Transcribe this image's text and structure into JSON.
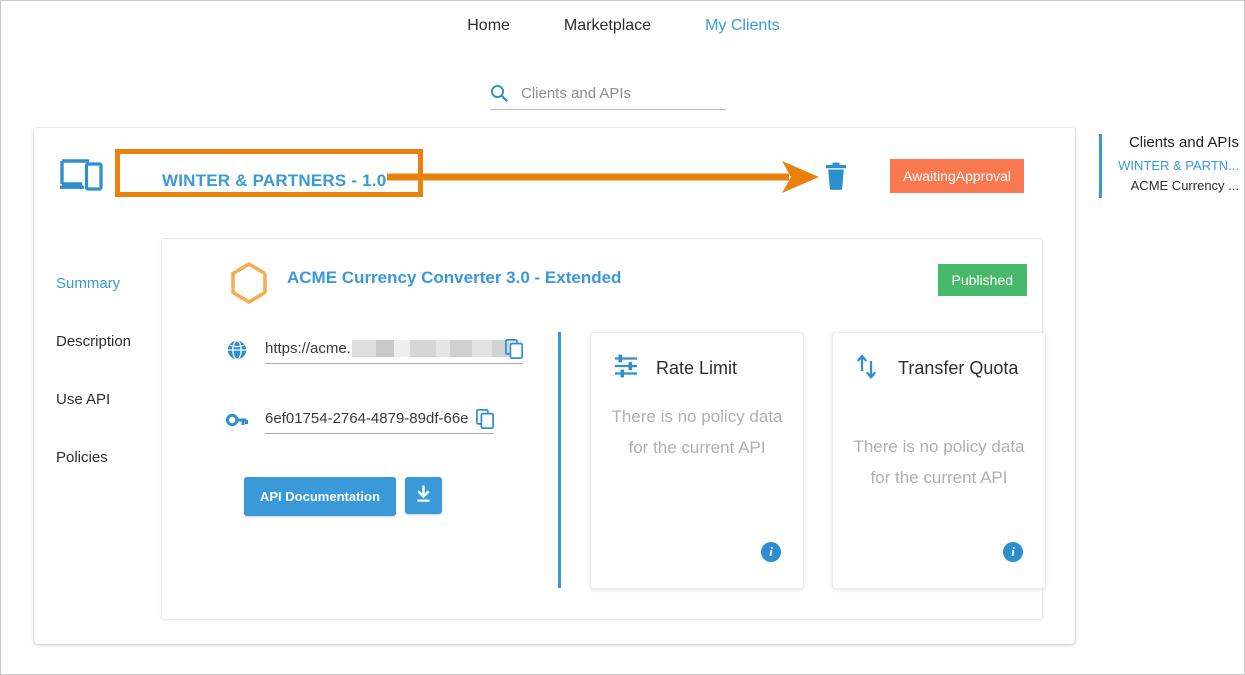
{
  "topnav": {
    "items": [
      {
        "label": "Home",
        "active": false
      },
      {
        "label": "Marketplace",
        "active": false
      },
      {
        "label": "My Clients",
        "active": true
      }
    ]
  },
  "search": {
    "placeholder": "Clients and APIs",
    "value": "",
    "icon": "search-icon"
  },
  "client_header": {
    "icon": "devices-icon",
    "title": "WINTER & PARTNERS - 1.0",
    "delete_icon": "trash-icon",
    "status_label": "AwaitingApproval",
    "status_color": "#f9784f",
    "highlight_color": "#e8820c"
  },
  "tabs": [
    {
      "label": "Summary",
      "active": true
    },
    {
      "label": "Description",
      "active": false
    },
    {
      "label": "Use API",
      "active": false
    },
    {
      "label": "Policies",
      "active": false
    }
  ],
  "api_card": {
    "icon": "hexagon-icon",
    "title": "ACME Currency Converter 3.0 - Extended",
    "state_label": "Published",
    "state_color": "#48b968",
    "fields": [
      {
        "icon": "globe-icon",
        "name": "api-endpoint-url",
        "value": "https://acme.",
        "redacted": true,
        "copy_icon": "copy-icon"
      },
      {
        "icon": "key-icon",
        "name": "api-key",
        "value": "6ef01754-2764-4879-89df-66e",
        "redacted": false,
        "copy_icon": "copy-icon"
      }
    ],
    "buttons": {
      "documentation_label": "API Documentation",
      "download_icon": "download-icon",
      "accent_color": "#3a9ad9"
    }
  },
  "policies": [
    {
      "icon": "sliders-icon",
      "name": "Rate Limit",
      "empty_text": "There is no policy data for the current API",
      "info_icon": "info-icon"
    },
    {
      "icon": "transfer-arrows-icon",
      "name": "Transfer Quota",
      "empty_text": "There is no policy data for the current API",
      "info_icon": "info-icon"
    }
  ],
  "tree": {
    "title": "Clients and APIs",
    "items": [
      {
        "label": "WINTER & PARTN...",
        "active": true
      },
      {
        "label": "ACME Currency ...",
        "active": false
      }
    ]
  }
}
